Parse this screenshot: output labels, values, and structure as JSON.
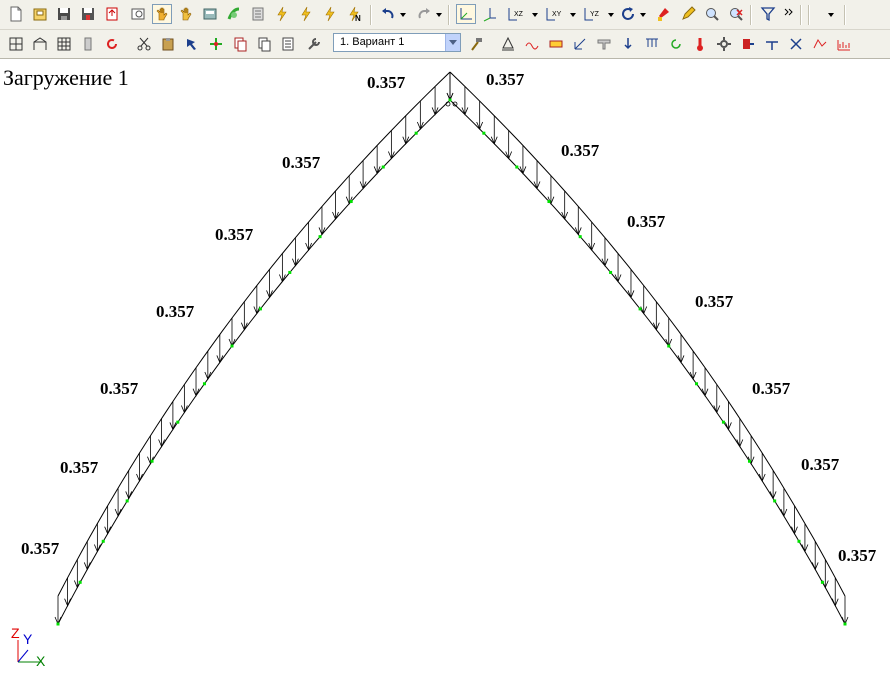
{
  "window": {
    "loadcase_title": "Загружение 1"
  },
  "toolbar1": {
    "buttons": [
      {
        "name": "new-file-icon"
      },
      {
        "name": "open-file-icon"
      },
      {
        "name": "save-icon"
      },
      {
        "name": "save-as-icon"
      },
      {
        "name": "export-icon"
      },
      {
        "name": "print-preview-icon"
      },
      {
        "name": "pan-hand-icon",
        "active": true
      },
      {
        "name": "rotate-hand-icon"
      },
      {
        "name": "calculator-icon"
      },
      {
        "name": "analysis-icon"
      },
      {
        "name": "document-icon"
      },
      {
        "name": "forces-s-icon"
      },
      {
        "name": "forces-m-icon"
      },
      {
        "name": "forces-q-icon"
      },
      {
        "name": "forces-n-icon"
      },
      {
        "name": "undo-icon"
      },
      {
        "name": "redo-icon"
      },
      {
        "name": "view-3d-axes-icon"
      },
      {
        "name": "view-axes-icon"
      },
      {
        "name": "view-xz-icon"
      },
      {
        "name": "view-xy-icon"
      },
      {
        "name": "view-yz-icon"
      },
      {
        "name": "rotate-view-icon"
      },
      {
        "name": "paint-icon"
      },
      {
        "name": "pencil-icon"
      },
      {
        "name": "zoom-icon"
      },
      {
        "name": "zoom-out-icon"
      },
      {
        "name": "filter-icon"
      },
      {
        "name": "more-icon"
      }
    ],
    "view_xz": "XZ",
    "view_xy": "XY",
    "view_yz": "YZ"
  },
  "toolbar2": {
    "variant_select": {
      "value": "1. Вариант 1"
    }
  },
  "colors": {
    "node": "#00e000",
    "line": "#000000",
    "axis_z": "#e00000",
    "axis_y": "#0000cc",
    "axis_x": "#008000"
  },
  "load_labels": [
    {
      "text": "0.357",
      "side": "left"
    },
    {
      "text": "0.357",
      "side": "left"
    },
    {
      "text": "0.357",
      "side": "left"
    },
    {
      "text": "0.357",
      "side": "left"
    },
    {
      "text": "0.357",
      "side": "left"
    },
    {
      "text": "0.357",
      "side": "left"
    },
    {
      "text": "0.357",
      "side": "left"
    },
    {
      "text": "0.357",
      "side": "right"
    },
    {
      "text": "0.357",
      "side": "right"
    },
    {
      "text": "0.357",
      "side": "right"
    },
    {
      "text": "0.357",
      "side": "right"
    },
    {
      "text": "0.357",
      "side": "right"
    },
    {
      "text": "0.357",
      "side": "right"
    },
    {
      "text": "0.357",
      "side": "right"
    }
  ],
  "axes": {
    "z": "Z",
    "y": "Y",
    "x": "X"
  }
}
